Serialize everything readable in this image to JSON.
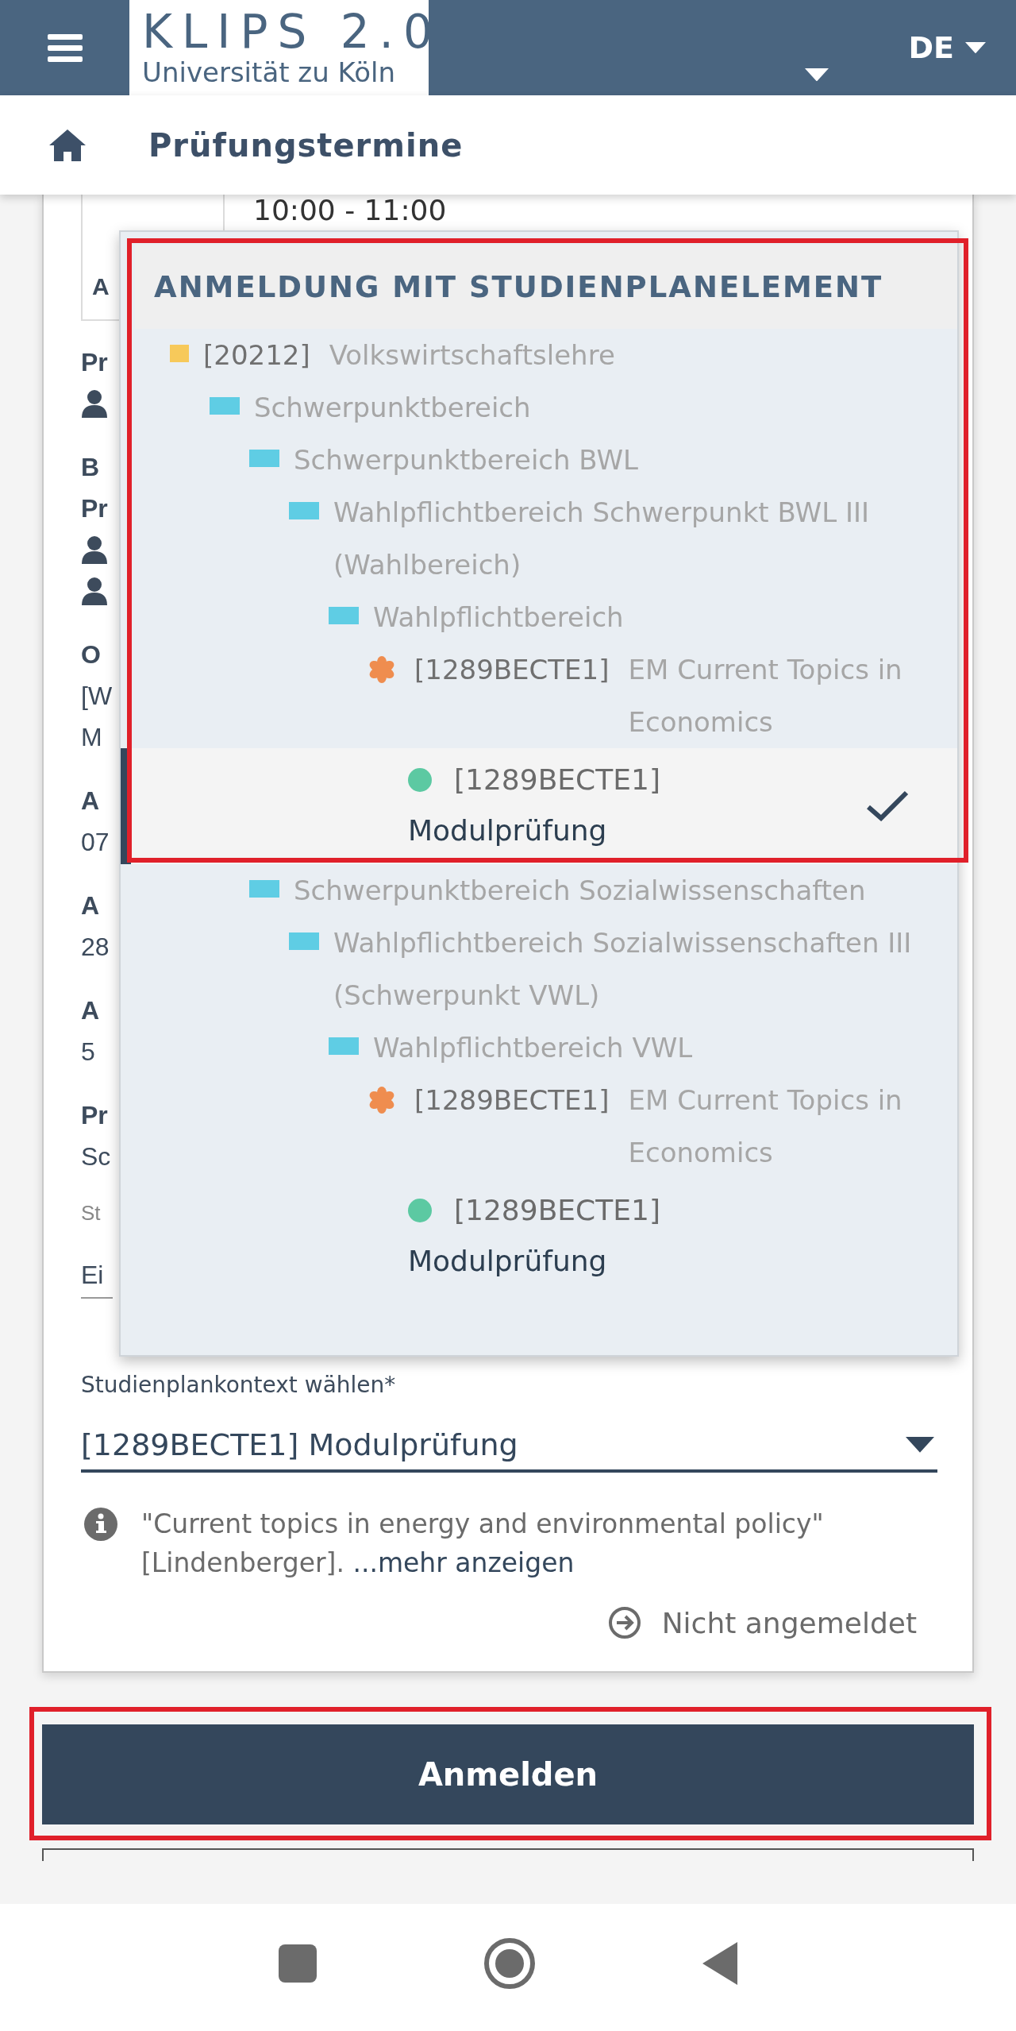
{
  "header": {
    "logo_title": "KLIPS 2.0",
    "logo_subtitle": "Universität zu Köln",
    "language": "DE"
  },
  "breadcrumb": {
    "title": "Prüfungstermine"
  },
  "card": {
    "time": "10:00 - 11:00",
    "date_box_text": "A",
    "fragments": [
      {
        "kind": "label",
        "text": "Pr"
      },
      {
        "kind": "person"
      },
      {
        "kind": "label",
        "text": "B"
      },
      {
        "kind": "label",
        "text": "Pr"
      },
      {
        "kind": "person"
      },
      {
        "kind": "person"
      },
      {
        "kind": "label",
        "text": "O"
      },
      {
        "kind": "value",
        "text": "[W"
      },
      {
        "kind": "value",
        "text": "M"
      },
      {
        "kind": "label",
        "text": "A"
      },
      {
        "kind": "value",
        "text": "07"
      },
      {
        "kind": "label",
        "text": "A"
      },
      {
        "kind": "value",
        "text": "28"
      },
      {
        "kind": "label",
        "text": "A"
      },
      {
        "kind": "value",
        "text": "5"
      },
      {
        "kind": "label",
        "text": "Pr"
      },
      {
        "kind": "value",
        "text": "Sc"
      },
      {
        "kind": "hint",
        "text": "St"
      },
      {
        "kind": "input",
        "text": "Ei"
      }
    ],
    "select": {
      "label": "Studienplankontext wählen*",
      "value": "[1289BECTE1]  Modulprüfung"
    },
    "info": {
      "text": "\"Current topics in energy and environmental policy\" [Lindenberger].",
      "link": "...mehr anzeigen"
    },
    "status": "Nicht angemeldet"
  },
  "register_button": "Anmelden",
  "dropdown": {
    "title": "ANMELDUNG MIT STUDIENPLANELEMENT",
    "tree": [
      {
        "kind": "area",
        "code": "[20212]",
        "name": "Volkswirtschaftslehre",
        "color": "#f7c95a",
        "children": [
          {
            "kind": "area",
            "name": "Schwerpunktbereich",
            "color": "#5fcde4",
            "children": [
              {
                "kind": "area",
                "name": "Schwerpunktbereich BWL",
                "color": "#5fcde4",
                "children": [
                  {
                    "kind": "area",
                    "name": "Wahlpflichtbereich Schwerpunkt BWL III (Wahlbereich)",
                    "color": "#5fcde4",
                    "children": [
                      {
                        "kind": "area",
                        "name": "Wahlpflichtbereich",
                        "color": "#5fcde4",
                        "children": [
                          {
                            "kind": "module",
                            "code": "[1289BECTE1]",
                            "name": "EM Current Topics in Economics",
                            "color": "#ef8d4f",
                            "children": [
                              {
                                "kind": "exam",
                                "code": "[1289BECTE1]",
                                "name": "Modulprüfung",
                                "color": "#5cc9a2",
                                "selected": true
                              }
                            ]
                          }
                        ]
                      }
                    ]
                  }
                ]
              },
              {
                "kind": "area",
                "name": "Schwerpunktbereich Sozialwissenschaften",
                "color": "#5fcde4",
                "children": [
                  {
                    "kind": "area",
                    "name": "Wahlpflichtbereich Sozialwissenschaften III (Schwerpunkt VWL)",
                    "color": "#5fcde4",
                    "children": [
                      {
                        "kind": "area",
                        "name": "Wahlpflichtbereich VWL",
                        "color": "#5fcde4",
                        "children": [
                          {
                            "kind": "module",
                            "code": "[1289BECTE1]",
                            "name": "EM Current Topics in Economics",
                            "color": "#ef8d4f",
                            "children": [
                              {
                                "kind": "exam",
                                "code": "[1289BECTE1]",
                                "name": "Modulprüfung",
                                "color": "#5cc9a2",
                                "selected": false
                              }
                            ]
                          }
                        ]
                      }
                    ]
                  }
                ]
              }
            ]
          }
        ]
      }
    ]
  }
}
